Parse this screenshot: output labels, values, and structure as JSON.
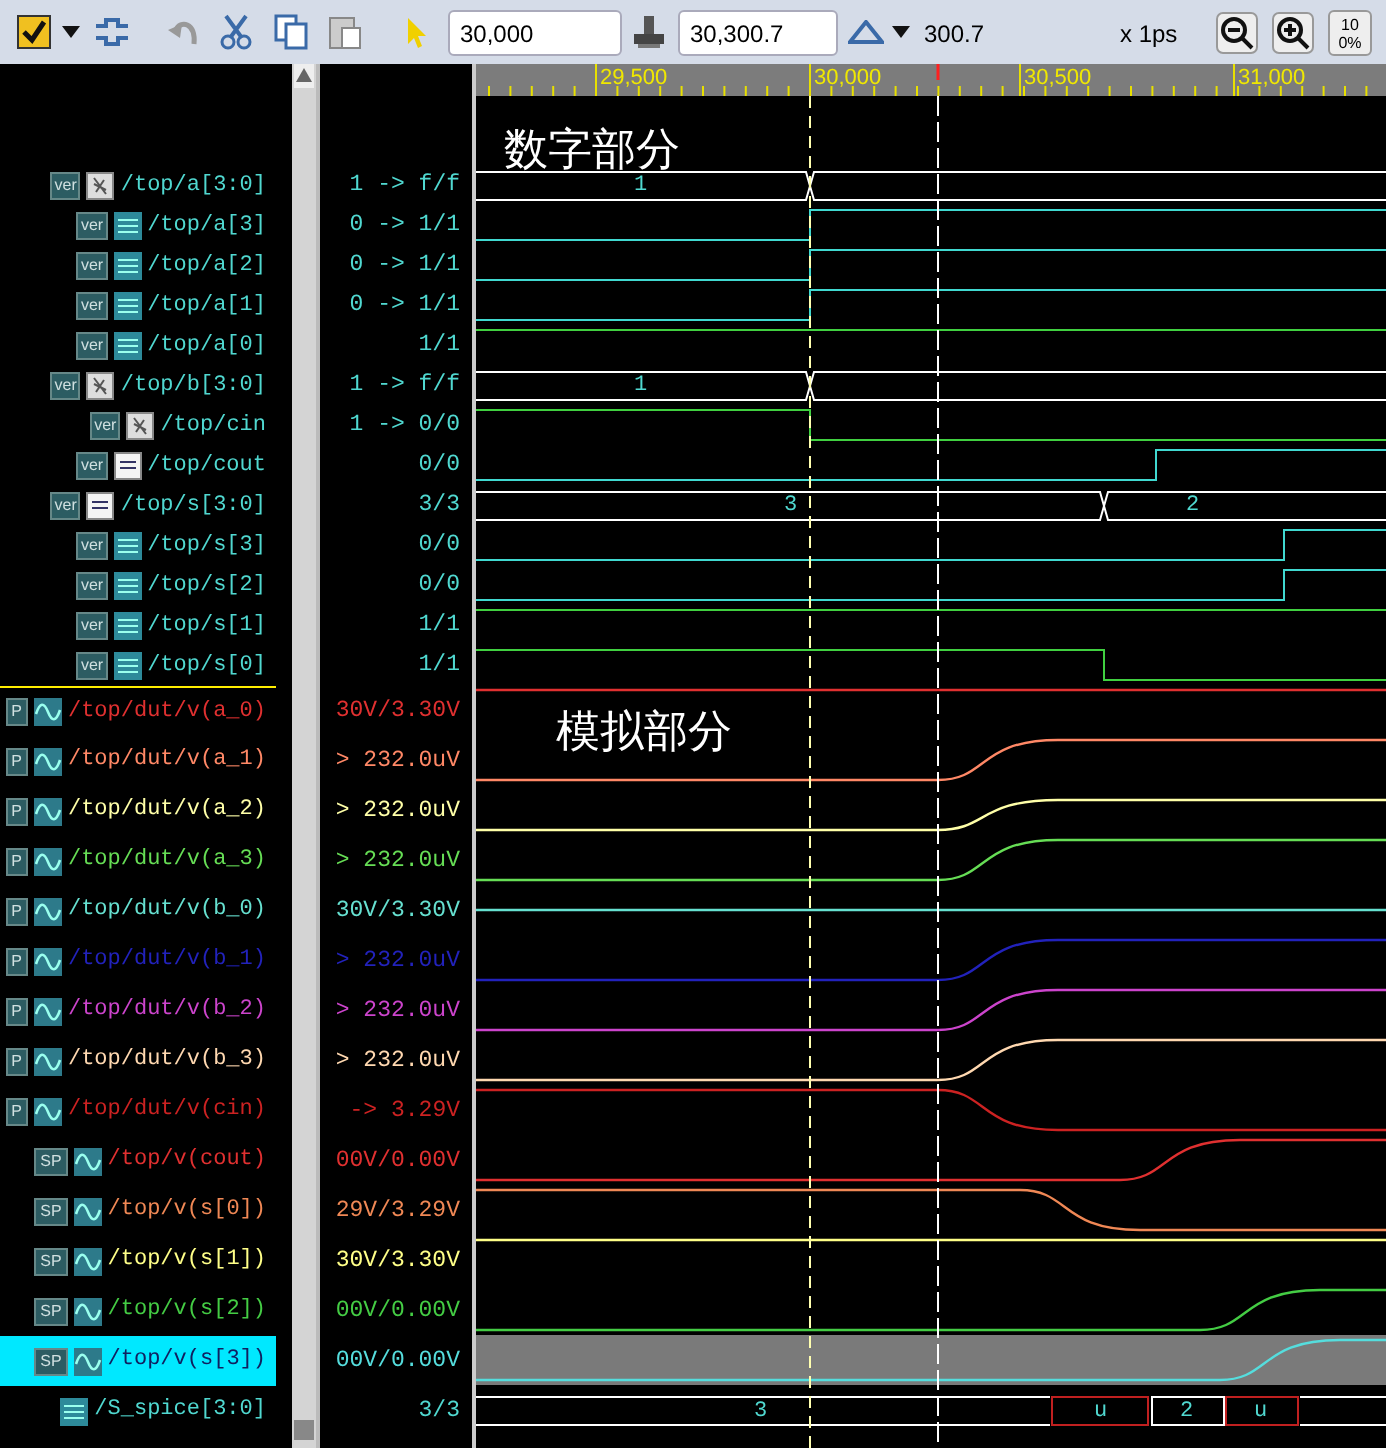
{
  "toolbar": {
    "start_time": "30,000",
    "cursor_time": "30,300.7",
    "delta": "300.7",
    "scale": "x 1ps",
    "zoom_full": "100%"
  },
  "ruler": {
    "ticks": [
      "29,500",
      "30,000",
      "30,500",
      "31,000"
    ]
  },
  "annotations": [
    "数字部分",
    "模拟部分"
  ],
  "signals": [
    {
      "name": "/top/a[3:0]",
      "value": "1 -> f/f",
      "source": "ver",
      "kind": "bus",
      "color": "#50d8d0",
      "selected": false,
      "wave_labels": [
        "1"
      ]
    },
    {
      "name": "/top/a[3]",
      "value": "0 -> 1/1",
      "source": "ver",
      "kind": "bit",
      "color": "#50d8d0",
      "selected": false
    },
    {
      "name": "/top/a[2]",
      "value": "0 -> 1/1",
      "source": "ver",
      "kind": "bit",
      "color": "#50d8d0",
      "selected": false
    },
    {
      "name": "/top/a[1]",
      "value": "0 -> 1/1",
      "source": "ver",
      "kind": "bit",
      "color": "#50d8d0",
      "selected": false
    },
    {
      "name": "/top/a[0]",
      "value": "1/1",
      "source": "ver",
      "kind": "bit",
      "color": "#50d8d0",
      "selected": false
    },
    {
      "name": "/top/b[3:0]",
      "value": "1 -> f/f",
      "source": "ver",
      "kind": "bus",
      "color": "#50d8d0",
      "selected": false,
      "wave_labels": [
        "1"
      ]
    },
    {
      "name": "/top/cin",
      "value": "1 -> 0/0",
      "source": "ver",
      "kind": "busbit",
      "color": "#50d8d0",
      "selected": false
    },
    {
      "name": "/top/cout",
      "value": "0/0",
      "source": "ver",
      "kind": "net",
      "color": "#50d8d0",
      "selected": false
    },
    {
      "name": "/top/s[3:0]",
      "value": "3/3",
      "source": "ver",
      "kind": "netbus",
      "color": "#50d8d0",
      "selected": false,
      "wave_labels": [
        "3",
        "2"
      ]
    },
    {
      "name": "/top/s[3]",
      "value": "0/0",
      "source": "ver",
      "kind": "bit",
      "color": "#50d8d0",
      "selected": false
    },
    {
      "name": "/top/s[2]",
      "value": "0/0",
      "source": "ver",
      "kind": "bit",
      "color": "#50d8d0",
      "selected": false
    },
    {
      "name": "/top/s[1]",
      "value": "1/1",
      "source": "ver",
      "kind": "bit",
      "color": "#50d8d0",
      "selected": false
    },
    {
      "name": "/top/s[0]",
      "value": "1/1",
      "source": "ver",
      "kind": "bit",
      "color": "#50d8d0",
      "selected": false
    },
    {
      "name": "/top/dut/v(a_0)",
      "value": "30V/3.30V",
      "source": "P",
      "kind": "analog",
      "color": "#e03030",
      "selected": false
    },
    {
      "name": "/top/dut/v(a_1)",
      "value": "> 232.0uV",
      "source": "P",
      "kind": "analog",
      "color": "#ff8866",
      "selected": false
    },
    {
      "name": "/top/dut/v(a_2)",
      "value": "> 232.0uV",
      "source": "P",
      "kind": "analog",
      "color": "#ffffa8",
      "selected": false
    },
    {
      "name": "/top/dut/v(a_3)",
      "value": "> 232.0uV",
      "source": "P",
      "kind": "analog",
      "color": "#66dd55",
      "selected": false
    },
    {
      "name": "/top/dut/v(b_0)",
      "value": "30V/3.30V",
      "source": "P",
      "kind": "analog",
      "color": "#66e0d0",
      "selected": false
    },
    {
      "name": "/top/dut/v(b_1)",
      "value": "> 232.0uV",
      "source": "P",
      "kind": "analog",
      "color": "#2222bb",
      "selected": false
    },
    {
      "name": "/top/dut/v(b_2)",
      "value": "> 232.0uV",
      "source": "P",
      "kind": "analog",
      "color": "#cc44cc",
      "selected": false
    },
    {
      "name": "/top/dut/v(b_3)",
      "value": "> 232.0uV",
      "source": "P",
      "kind": "analog",
      "color": "#ffd8b0",
      "selected": false
    },
    {
      "name": "/top/dut/v(cin)",
      "value": "-> 3.29V",
      "source": "P",
      "kind": "analog",
      "color": "#cc2222",
      "selected": false
    },
    {
      "name": "/top/v(cout)",
      "value": "00V/0.00V",
      "source": "SP",
      "kind": "analog",
      "color": "#e03030",
      "selected": false
    },
    {
      "name": "/top/v(s[0])",
      "value": "29V/3.29V",
      "source": "SP",
      "kind": "analog",
      "color": "#f08855",
      "selected": false
    },
    {
      "name": "/top/v(s[1])",
      "value": "30V/3.30V",
      "source": "SP",
      "kind": "analog",
      "color": "#ffff88",
      "selected": false
    },
    {
      "name": "/top/v(s[2])",
      "value": "00V/0.00V",
      "source": "SP",
      "kind": "analog",
      "color": "#44cc44",
      "selected": false
    },
    {
      "name": "/top/v(s[3])",
      "value": "00V/0.00V",
      "source": "SP",
      "kind": "analog",
      "color": "#55dddd",
      "selected": true
    },
    {
      "name": "/S_spice[3:0]",
      "value": "3/3",
      "kind": "bit",
      "color": "#50d8d0",
      "selected": false,
      "wave_labels": [
        "3",
        "u",
        "2",
        "u"
      ]
    }
  ]
}
